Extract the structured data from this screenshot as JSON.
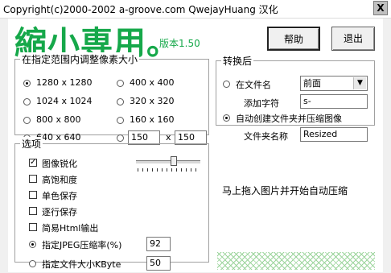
{
  "window": {
    "title": "Copyright(c)2000-2002 a-groove.com QwejayHuang 汉化",
    "close_label": "X"
  },
  "logo": {
    "title": "縮小専用。",
    "version": "版本1.50"
  },
  "buttons": {
    "help": "帮助",
    "exit": "退出"
  },
  "size_group": {
    "label": "在指定范围内调整像素大小",
    "options": [
      {
        "label": "1280 x 1280",
        "selected": true
      },
      {
        "label": "400 x 400",
        "selected": false
      },
      {
        "label": "1024 x 1024",
        "selected": false
      },
      {
        "label": "320 x 320",
        "selected": false
      },
      {
        "label": "800 x 800",
        "selected": false
      },
      {
        "label": "160 x 160",
        "selected": false
      },
      {
        "label": "640 x 640",
        "selected": false
      }
    ],
    "custom": {
      "width": "150",
      "separator": "x",
      "height": "150"
    }
  },
  "convert_group": {
    "label": "转换后",
    "filename_radio": "在文件名",
    "position_select": "前面",
    "add_char_label": "添加字符",
    "add_char_value": "s-",
    "folder_radio": "自动创建文件夹并压缩图像",
    "folder_name_label": "文件夹名称",
    "folder_name_value": "Resized"
  },
  "options_group": {
    "label": "选项",
    "items": [
      {
        "label": "图像锐化",
        "checked": true
      },
      {
        "label": "高饱和度",
        "checked": false
      },
      {
        "label": "单色保存",
        "checked": false
      },
      {
        "label": "逐行保存",
        "checked": false
      },
      {
        "label": "简易Html输出",
        "checked": false
      }
    ],
    "jpeg_quality_label": "指定JPEG压缩率(%)",
    "jpeg_quality_value": "92",
    "filesize_label": "指定文件大小KByte",
    "filesize_value": "50"
  },
  "drop_hint": "马上拖入图片并开始自动压缩"
}
